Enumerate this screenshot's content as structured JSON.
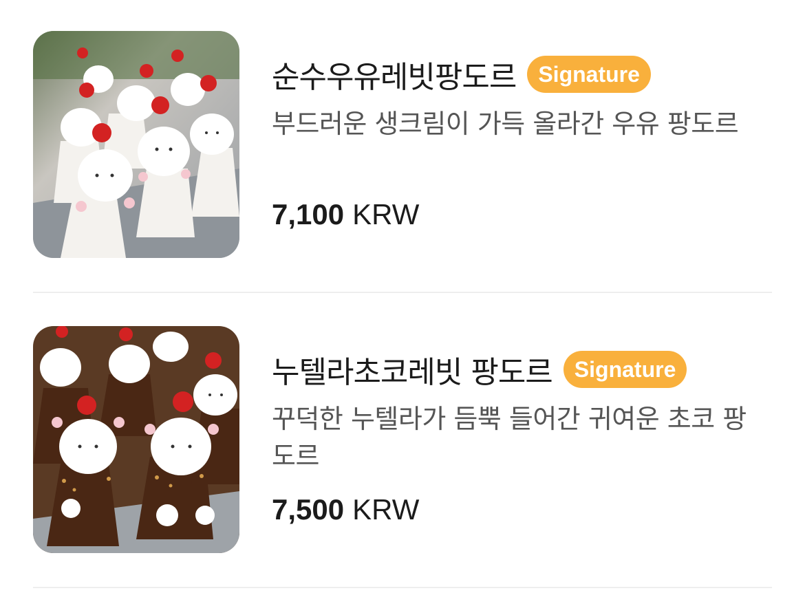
{
  "theme": {
    "badge_color": "#F9B03C",
    "divider_color": "#EEEEEE"
  },
  "menu": {
    "items": [
      {
        "title": "순수우유레빗팡도르",
        "badge": "Signature",
        "description": "부드러운 생크림이 가득 올라간 우유 팡도르",
        "price": "7,100",
        "currency": "KRW"
      },
      {
        "title": "누텔라초코레빗 팡도르",
        "badge": "Signature",
        "description": "꾸덕한 누텔라가 듬뿍 들어간 귀여운 초코 팡도르",
        "price": "7,500",
        "currency": "KRW"
      }
    ]
  }
}
